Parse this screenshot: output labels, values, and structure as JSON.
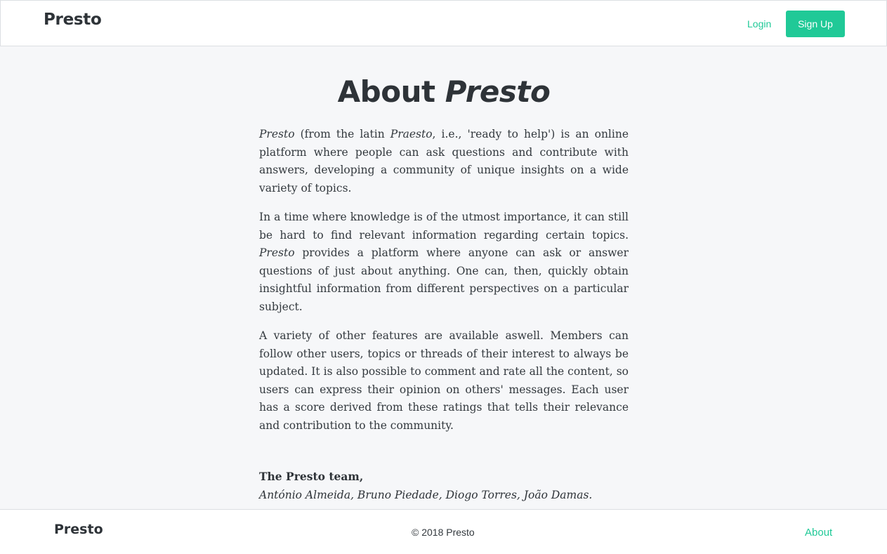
{
  "navbar": {
    "brand": "Presto",
    "login_label": "Login",
    "signup_label": "Sign Up"
  },
  "main": {
    "title_plain": "About",
    "title_italic": "Presto",
    "paragraphs": [
      {
        "italic_start": "Presto",
        "text_1": " (from the latin ",
        "italic_mid": "Praesto",
        "text_2": ", i.e., 'ready to help') is an online platform where people can ask questions and contribute with answers, developing a community of unique insights on a wide variety of topics."
      },
      {
        "text_1": "In a time where knowledge is of the utmost importance, it can still be hard to find relevant information regarding certain topics. ",
        "italic_mid": "Presto",
        "text_2": " provides a platform where anyone can ask or answer questions of just about anything. One can, then, quickly obtain insightful information from different perspectives on a particular subject."
      },
      {
        "text_1": "A variety of other features are available aswell. Members can follow other users, topics or threads of their interest to always be updated. It is also possible to comment and rate all the content, so users can express their opinion on others' messages. Each user has a score derived from these ratings that tells their relevance and contribution to the community."
      }
    ],
    "signature_title": "The Presto team,",
    "signature_names": "António Almeida, Bruno Piedade, Diogo Torres, João Damas."
  },
  "footer": {
    "brand": "Presto",
    "copyright": "© 2018 Presto",
    "about_label": "About"
  },
  "colors": {
    "accent": "#20c997",
    "background": "#f6f7f9",
    "text": "#333a40"
  }
}
